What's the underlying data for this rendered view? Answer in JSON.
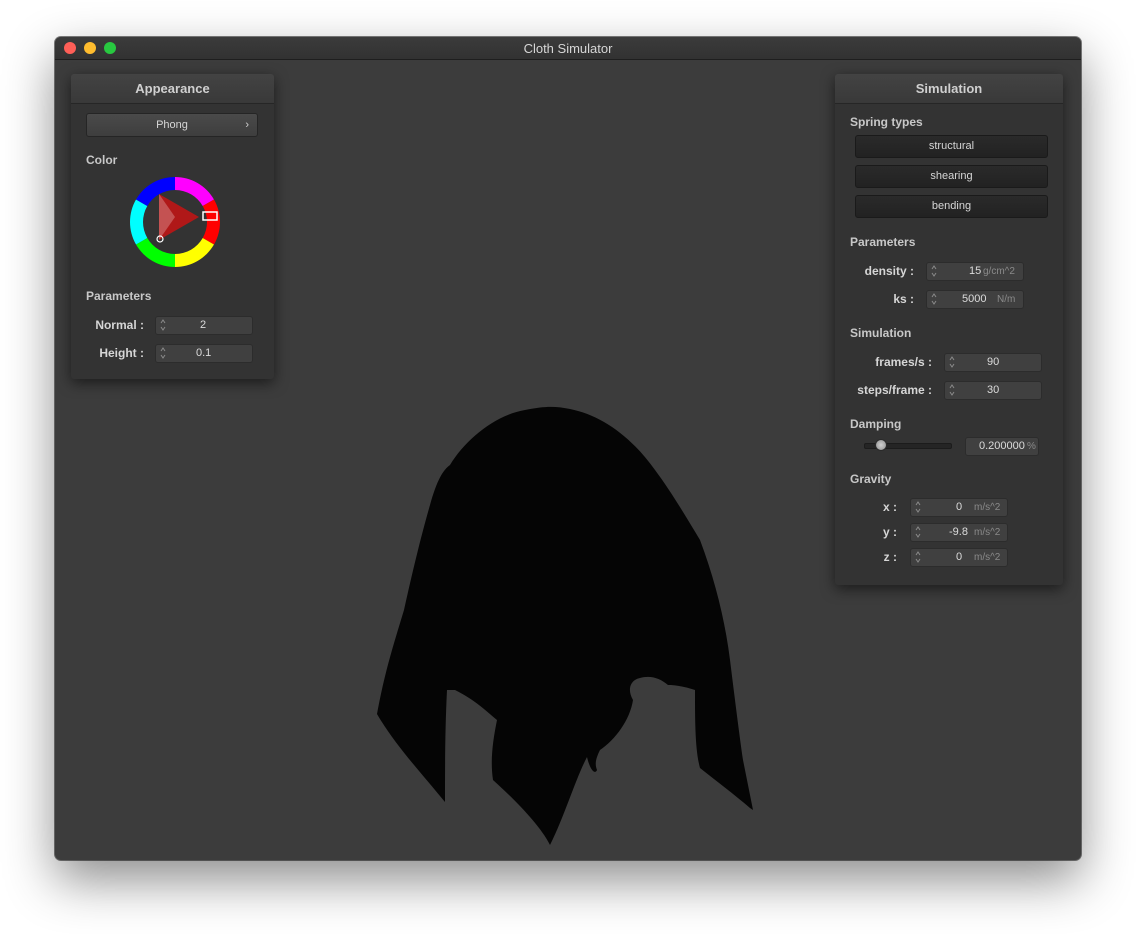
{
  "window": {
    "title": "Cloth Simulator"
  },
  "appearance": {
    "header": "Appearance",
    "shader": "Phong",
    "color_label": "Color",
    "color": "#e01818",
    "parameters_label": "Parameters",
    "normal": {
      "label": "Normal :",
      "value": "2"
    },
    "height": {
      "label": "Height :",
      "value": "0.1"
    }
  },
  "simulation": {
    "header": "Simulation",
    "spring_types_label": "Spring types",
    "spring_buttons": [
      "structural",
      "shearing",
      "bending"
    ],
    "parameters_label": "Parameters",
    "density": {
      "label": "density :",
      "value": "15",
      "unit": "g/cm^2"
    },
    "ks": {
      "label": "ks :",
      "value": "5000",
      "unit": "N/m"
    },
    "simulation_label": "Simulation",
    "fps": {
      "label": "frames/s :",
      "value": "90"
    },
    "steps": {
      "label": "steps/frame :",
      "value": "30"
    },
    "damping_label": "Damping",
    "damping": {
      "value": "0.200000",
      "unit": "%",
      "fraction": 0.2
    },
    "gravity_label": "Gravity",
    "gx": {
      "label": "x :",
      "value": "0",
      "unit": "m/s^2"
    },
    "gy": {
      "label": "y :",
      "value": "-9.8",
      "unit": "m/s^2"
    },
    "gz": {
      "label": "z :",
      "value": "0",
      "unit": "m/s^2"
    }
  },
  "icons": [
    "chevron-right-icon",
    "spinner-icon",
    "color-wheel"
  ]
}
